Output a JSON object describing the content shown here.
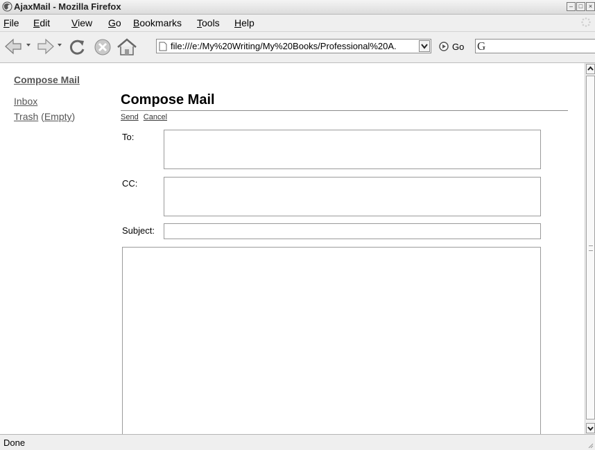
{
  "window": {
    "title": "AjaxMail - Mozilla Firefox"
  },
  "menu": [
    {
      "key": "F",
      "rest": "ile"
    },
    {
      "key": "E",
      "rest": "dit"
    },
    {
      "key": "V",
      "rest": "iew"
    },
    {
      "key": "G",
      "rest": "o"
    },
    {
      "key": "B",
      "rest": "ookmarks"
    },
    {
      "key": "T",
      "rest": "ools"
    },
    {
      "key": "H",
      "rest": "elp"
    }
  ],
  "toolbar": {
    "url": "file:///e:/My%20Writing/My%20Books/Professional%20A.",
    "go_label": "Go",
    "search_engine_glyph": "G"
  },
  "sidebar": {
    "compose_label": "Compose Mail",
    "inbox_label": "Inbox",
    "trash_label": "Trash",
    "empty_label": "Empty"
  },
  "compose": {
    "title": "Compose Mail",
    "send_label": "Send",
    "cancel_label": "Cancel",
    "to_label": "To:",
    "cc_label": "CC:",
    "subject_label": "Subject:",
    "to_value": "",
    "cc_value": "",
    "subject_value": "",
    "body_value": ""
  },
  "status": {
    "text": "Done"
  },
  "colors": {
    "link": "#555555",
    "chrome": "#efefef",
    "border": "#9a9a9a"
  }
}
